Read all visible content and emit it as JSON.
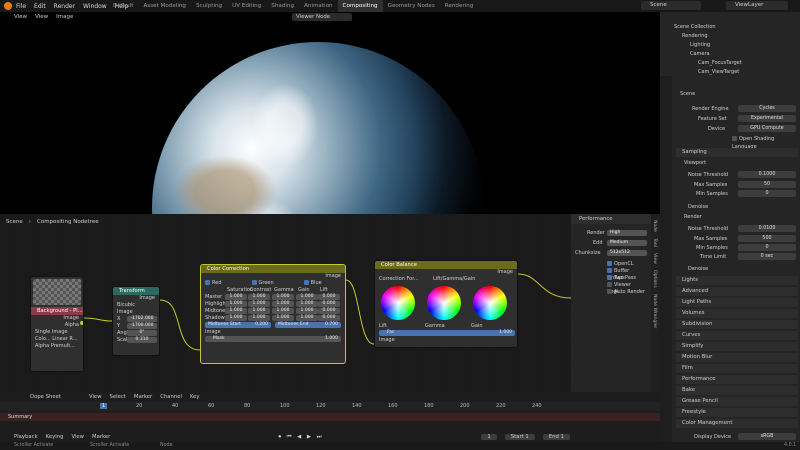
{
  "menu": [
    "File",
    "Edit",
    "Render",
    "Window",
    "Help"
  ],
  "workspaces": [
    "Default",
    "Asset Modeling",
    "Sculpting",
    "UV Editing",
    "Shading",
    "Animation",
    "Compositing",
    "Geometry Nodes",
    "Rendering"
  ],
  "active_workspace": "Compositing",
  "scene_name": "Scene",
  "view_layer": "ViewLayer",
  "viewer": {
    "menu": [
      "View",
      "View",
      "Image"
    ],
    "node_name": "Viewer Node"
  },
  "node_editor": {
    "breadcrumb": [
      "Scene",
      "Compositing Nodetree"
    ]
  },
  "nodes": {
    "background": {
      "title": "Background - Pl...",
      "outputs": [
        "Image",
        "Alpha"
      ],
      "opts": [
        "Single Image",
        "Colo...",
        "Linear R...",
        "Alpha",
        "Premult..."
      ]
    },
    "transform": {
      "title": "Transform",
      "output": "Image",
      "input": "Image",
      "filter": "Bicubic",
      "fields": [
        {
          "l": "X",
          "v": "-1702.000"
        },
        {
          "l": "Y",
          "v": "-1700.000"
        },
        {
          "l": "Angle",
          "v": "0°"
        },
        {
          "l": "Scale",
          "v": "0.310"
        }
      ]
    },
    "color_correction": {
      "title": "Color Correction",
      "output": "Image",
      "checks": [
        "Red",
        "Green",
        "Blue"
      ],
      "cols": [
        "Saturation",
        "Contrast",
        "Gamma",
        "Gain",
        "Lift"
      ],
      "rows": [
        {
          "n": "Master",
          "v": [
            "1.000",
            "1.000",
            "1.000",
            "1.000",
            "0.000"
          ]
        },
        {
          "n": "Highlights",
          "v": [
            "1.000",
            "1.000",
            "1.000",
            "1.000",
            "0.000"
          ]
        },
        {
          "n": "Midtones",
          "v": [
            "1.000",
            "1.000",
            "1.000",
            "1.000",
            "0.000"
          ]
        },
        {
          "n": "Shadows",
          "v": [
            "1.000",
            "1.000",
            "1.000",
            "1.000",
            "0.000"
          ]
        }
      ],
      "midtones_start": "Midtones Start",
      "midtones_start_v": "0.200",
      "midtones_end": "Midtones End",
      "midtones_end_v": "0.700",
      "input": "Image",
      "mask": "Mask",
      "mask_v": "1.000"
    },
    "color_balance": {
      "title": "Color Balance",
      "output": "Image",
      "method": "Correction For...",
      "mode": "Lift/Gamma/Gain",
      "wheels": [
        "Lift",
        "Gamma",
        "Gain"
      ],
      "fac": "Fac",
      "fac_v": "1.000",
      "input": "Image"
    }
  },
  "performance": {
    "title": "Performance",
    "render_l": "Render",
    "render_v": "High",
    "edit_l": "Edit",
    "edit_v": "Medium",
    "chunk_l": "Chunksize",
    "chunk_v": "512x512",
    "checks": [
      {
        "l": "OpenCL",
        "on": true
      },
      {
        "l": "Buffer Groups",
        "on": true
      },
      {
        "l": "Two Pass",
        "on": true
      },
      {
        "l": "Viewer Regi...",
        "on": false
      },
      {
        "l": "Auto Render",
        "on": false
      }
    ]
  },
  "side_tabs": [
    "Node",
    "Tool",
    "View",
    "Options",
    "Node Wrangler"
  ],
  "dope": {
    "mode": "Dope Sheet",
    "menu": [
      "View",
      "Select",
      "Marker",
      "Channel",
      "Key"
    ],
    "frames": [
      "1",
      "20",
      "40",
      "60",
      "80",
      "100",
      "120",
      "140",
      "160",
      "180",
      "200",
      "220",
      "240"
    ],
    "summary": "Summary"
  },
  "playback": {
    "menu": [
      "Playback",
      "Keying",
      "View",
      "Marker"
    ],
    "current": "1",
    "start_l": "Start",
    "start_v": "1",
    "end_l": "End",
    "end_v": "1"
  },
  "status": {
    "left": "Scroller Activate",
    "mid": "Scroller Activate",
    "right": "Node",
    "version": "4.0.1"
  },
  "outliner": {
    "root": "Scene Collection",
    "items": [
      {
        "n": "Rendering",
        "d": 1
      },
      {
        "n": "Lighting",
        "d": 2
      },
      {
        "n": "Camera",
        "d": 2
      },
      {
        "n": "Cam_FocusTarget",
        "d": 3
      },
      {
        "n": "Cam_ViewTarget",
        "d": 3
      }
    ]
  },
  "props": {
    "scene": "Scene",
    "engine_l": "Render Engine",
    "engine_v": "Cycles",
    "feature_l": "Feature Set",
    "feature_v": "Experimental",
    "device_l": "Device",
    "device_v": "GPU Compute",
    "osl": "Open Shading Language",
    "sampling": "Sampling",
    "viewport": "Viewport",
    "noise_l": "Noise Threshold",
    "noise_v": "0.1000",
    "maxs_l": "Max Samples",
    "maxs_v": "50",
    "mins_l": "Min Samples",
    "mins_v": "0",
    "denoise": "Denoise",
    "render": "Render",
    "rnoise_v": "0.0100",
    "rmax_v": "500",
    "rmin_v": "0",
    "time_l": "Time Limit",
    "time_v": "0 sec",
    "panels": [
      "Lights",
      "Advanced",
      "Light Paths",
      "Volumes",
      "Subdivision",
      "Curves",
      "Simplify",
      "Motion Blur",
      "Film",
      "Performance",
      "Bake",
      "Grease Pencil",
      "Freestyle",
      "Color Management"
    ],
    "display_l": "Display Device",
    "display_v": "sRGB"
  }
}
